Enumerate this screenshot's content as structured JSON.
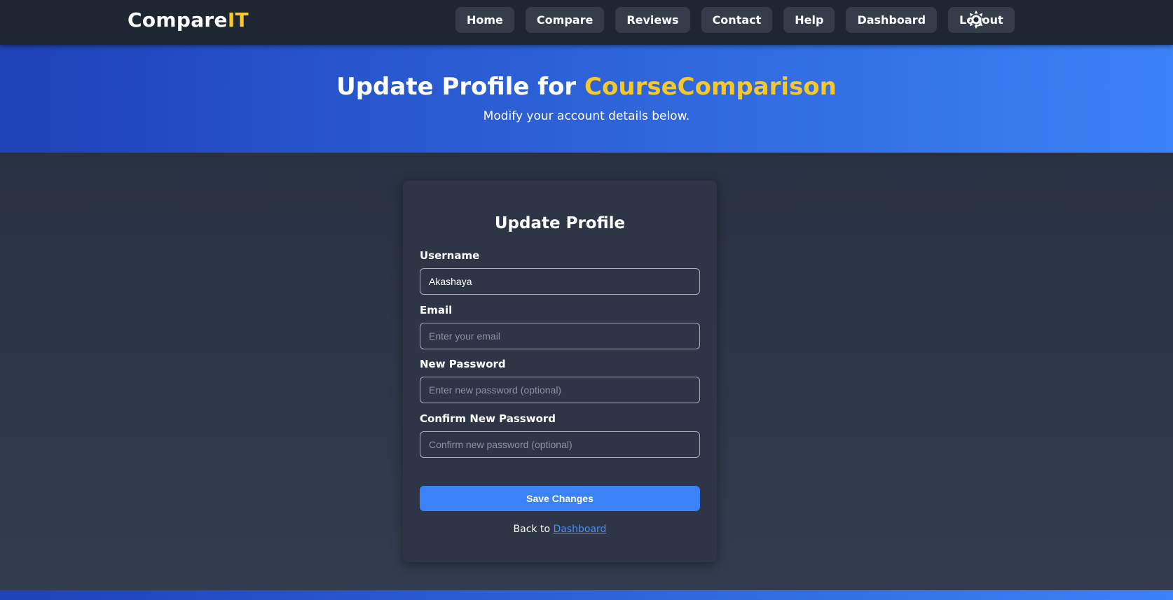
{
  "brand": {
    "name_main": "Compare",
    "name_accent": "IT",
    "accent_color": "#f6c829"
  },
  "nav": {
    "items": [
      {
        "label": "Home"
      },
      {
        "label": "Compare"
      },
      {
        "label": "Reviews"
      },
      {
        "label": "Contact"
      },
      {
        "label": "Help"
      },
      {
        "label": "Dashboard"
      },
      {
        "label": "Logout"
      }
    ],
    "theme_toggle_icon": "sun-icon"
  },
  "hero": {
    "title_prefix": "Update Profile for ",
    "title_highlight": "CourseComparison",
    "subtitle": "Modify your account details below."
  },
  "form": {
    "title": "Update Profile",
    "username": {
      "label": "Username",
      "value": "Akashaya"
    },
    "email": {
      "label": "Email",
      "value": "",
      "placeholder": "Enter your email"
    },
    "new_password": {
      "label": "New Password",
      "value": "",
      "placeholder": "Enter new password (optional)"
    },
    "confirm_password": {
      "label": "Confirm New Password",
      "value": "",
      "placeholder": "Confirm new password (optional)"
    },
    "submit_label": "Save Changes",
    "back_prefix": "Back to ",
    "back_link": "Dashboard"
  },
  "colors": {
    "primary": "#3b82f6",
    "navbar_bg": "#1e2533",
    "card_bg": "#2d3546",
    "hero_gradient_start": "#1e42b8",
    "hero_gradient_end": "#3b82f6"
  }
}
